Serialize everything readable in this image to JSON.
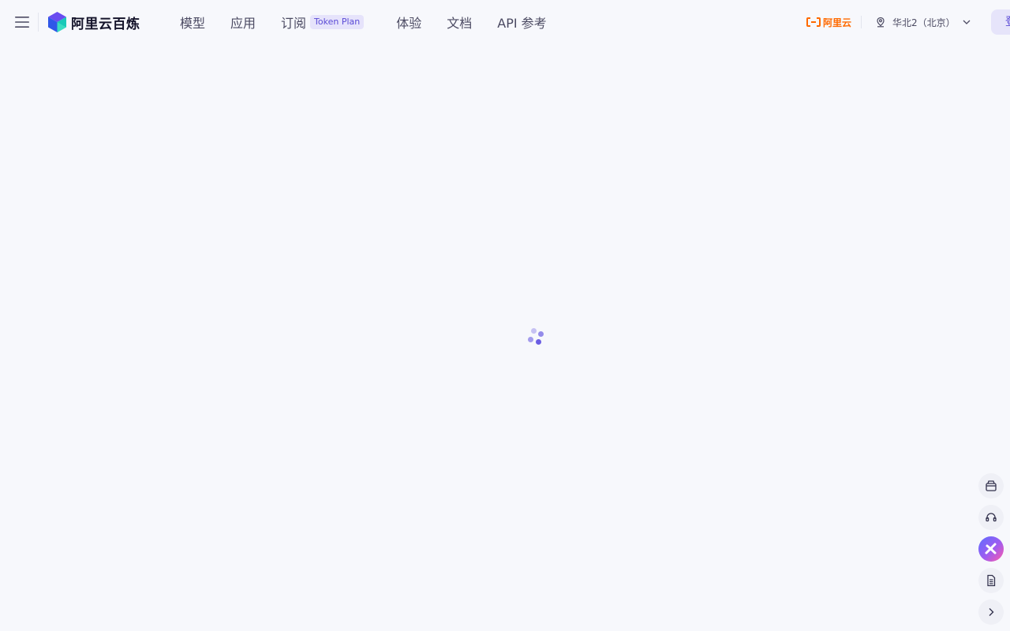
{
  "header": {
    "brand": "阿里云百炼",
    "nav": [
      {
        "label": "模型"
      },
      {
        "label": "应用"
      },
      {
        "label": "订阅",
        "badge": "Token Plan"
      },
      {
        "label": "体验"
      },
      {
        "label": "文档"
      },
      {
        "label": "API 参考"
      }
    ],
    "aliyun_label": "阿里云",
    "region": "华北2（北京）",
    "login_label": "登录"
  },
  "main": {
    "state": "loading"
  },
  "float_toolbar": {
    "items": [
      "shop-icon",
      "headset-icon",
      "ai-assistant-icon",
      "document-icon",
      "chevron-right-icon"
    ]
  },
  "colors": {
    "background": "#f7f8fc",
    "accent": "#5b4bd6",
    "aliyun_orange": "#ff6a00"
  }
}
